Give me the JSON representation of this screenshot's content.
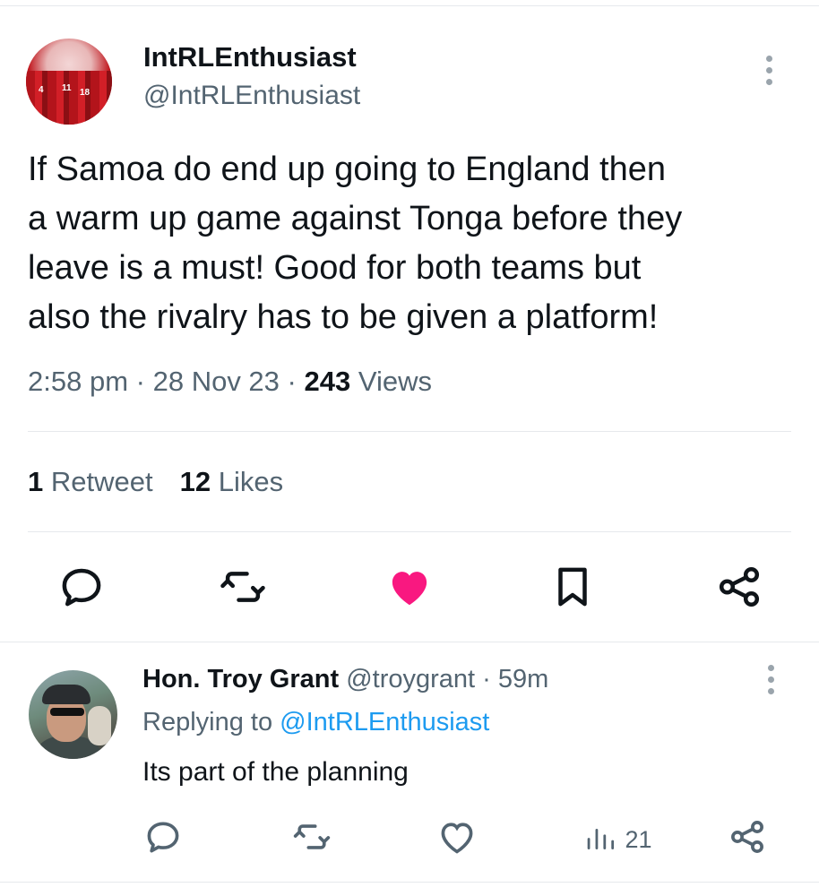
{
  "tweet": {
    "author_name": "IntRLEnthusiast",
    "author_handle": "@IntRLEnthusiast",
    "text": "If Samoa do end up going to England then\na warm up game against Tonga before they\nleave is a must! Good for both teams but\nalso the rivalry has to be given a platform!",
    "time": "2:58 pm",
    "date": "28 Nov 23",
    "views_count": "243",
    "views_label": "Views",
    "separator": "·",
    "retweets_count": "1",
    "retweets_label": "Retweet",
    "likes_count": "12",
    "likes_label": "Likes",
    "liked": true
  },
  "reply": {
    "author_name": "Hon. Troy Grant",
    "author_handle": "@troygrant",
    "time": "59m",
    "replying_label": "Replying to",
    "replying_handle": "@IntRLEnthusiast",
    "text": "Its part of the planning",
    "views_count": "21"
  },
  "colors": {
    "like_active": "#f91880",
    "icon_gray": "#536471",
    "link_blue": "#1d9bf0"
  },
  "icons": [
    "reply-icon",
    "retweet-icon",
    "like-icon",
    "bookmark-icon",
    "share-icon",
    "more-icon",
    "views-icon"
  ]
}
